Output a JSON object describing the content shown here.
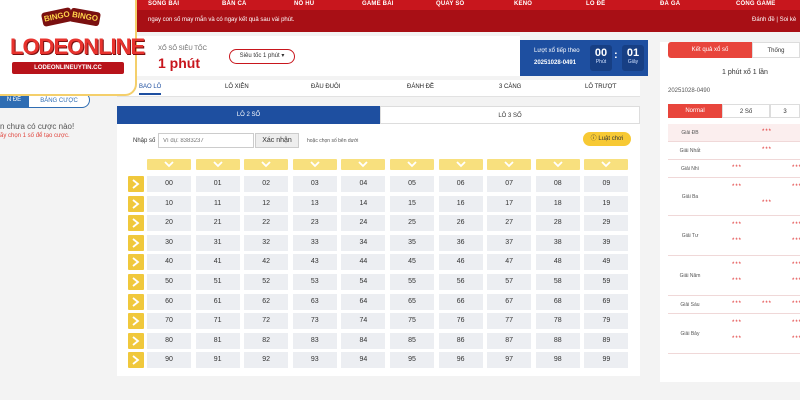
{
  "topnav": {
    "items": [
      "SÒNG BÀI",
      "BẮN CÁ",
      "NỔ HŨ",
      "GAME BÀI",
      "QUAY SỐ",
      "KENO",
      "LÔ ĐỀ",
      "ĐÁ GÀ",
      "CỔNG GAME"
    ]
  },
  "notice": {
    "message": "ngay con số may mắn và có ngay kết quả sau vài phút.",
    "links": "Đánh đề | Soi kè"
  },
  "logo": {
    "badge1": "BINGO",
    "badge2": "BINGO",
    "brand": "LODEONLINE",
    "site": "LODEONLINEUYTIN.CC"
  },
  "left": {
    "tab_a": "N ĐỀ",
    "tab_b": "BẢNG CƯỢC",
    "empty_title": "n chưa có cược nào!",
    "empty_hint": "ãy chọn 1 số để tạo cược."
  },
  "mode": {
    "small": "XỔ SỐ SIÊU TỐC",
    "big": "1 phút",
    "speed": "Siêu tốc 1 phút"
  },
  "countdown": {
    "label": "Lượt xổ tiếp theo",
    "draw_id": "20251028-0491",
    "minutes": "00",
    "minutes_unit": "Phút",
    "seconds": "01",
    "seconds_unit": "Giây"
  },
  "tabs": [
    "BAO LÔ",
    "LÔ XIÊN",
    "ĐẦU ĐUÔI",
    "ĐÁNH ĐỀ",
    "3 CÀNG",
    "LÔ TRƯỢT"
  ],
  "subtabs": [
    "LÔ 2 SỐ",
    "LÔ 3 SỐ"
  ],
  "board": {
    "input_label": "Nhập số",
    "input_placeholder": "Ví dụ: 8383237",
    "confirm": "Xác nhận",
    "or_choose": "hoặc chọn số bên dưới",
    "rules": "Luật chơi",
    "numbers": [
      [
        "00",
        "01",
        "02",
        "03",
        "04",
        "05",
        "06",
        "07",
        "08",
        "09"
      ],
      [
        "10",
        "11",
        "12",
        "13",
        "14",
        "15",
        "16",
        "17",
        "18",
        "19"
      ],
      [
        "20",
        "21",
        "22",
        "23",
        "24",
        "25",
        "26",
        "27",
        "28",
        "29"
      ],
      [
        "30",
        "31",
        "32",
        "33",
        "34",
        "35",
        "36",
        "37",
        "38",
        "39"
      ],
      [
        "40",
        "41",
        "42",
        "43",
        "44",
        "45",
        "46",
        "47",
        "48",
        "49"
      ],
      [
        "50",
        "51",
        "52",
        "53",
        "54",
        "55",
        "56",
        "57",
        "58",
        "59"
      ],
      [
        "60",
        "61",
        "62",
        "63",
        "64",
        "65",
        "66",
        "67",
        "68",
        "69"
      ],
      [
        "70",
        "71",
        "72",
        "73",
        "74",
        "75",
        "76",
        "77",
        "78",
        "79"
      ],
      [
        "80",
        "81",
        "82",
        "83",
        "84",
        "85",
        "86",
        "87",
        "88",
        "89"
      ],
      [
        "90",
        "91",
        "92",
        "93",
        "94",
        "95",
        "96",
        "97",
        "98",
        "99"
      ]
    ]
  },
  "results": {
    "tab_a": "Kết quả xổ số",
    "tab_b": "Thống",
    "mode": "1 phút xổ 1 lần",
    "draw_id": "20251028-0490",
    "sub_a": "Normal",
    "sub_b": "2 Số",
    "sub_c": "3",
    "prizes": [
      "Giải ĐB",
      "Giải Nhất",
      "Giải Nhì",
      "Giải Ba",
      "Giải Tư",
      "Giải Năm",
      "Giải Sáu",
      "Giải Bảy"
    ],
    "masked": "***"
  },
  "colors": {
    "brand_red": "#c8161d",
    "primary_blue": "#1e4fa0",
    "gold": "#f0c83c"
  }
}
